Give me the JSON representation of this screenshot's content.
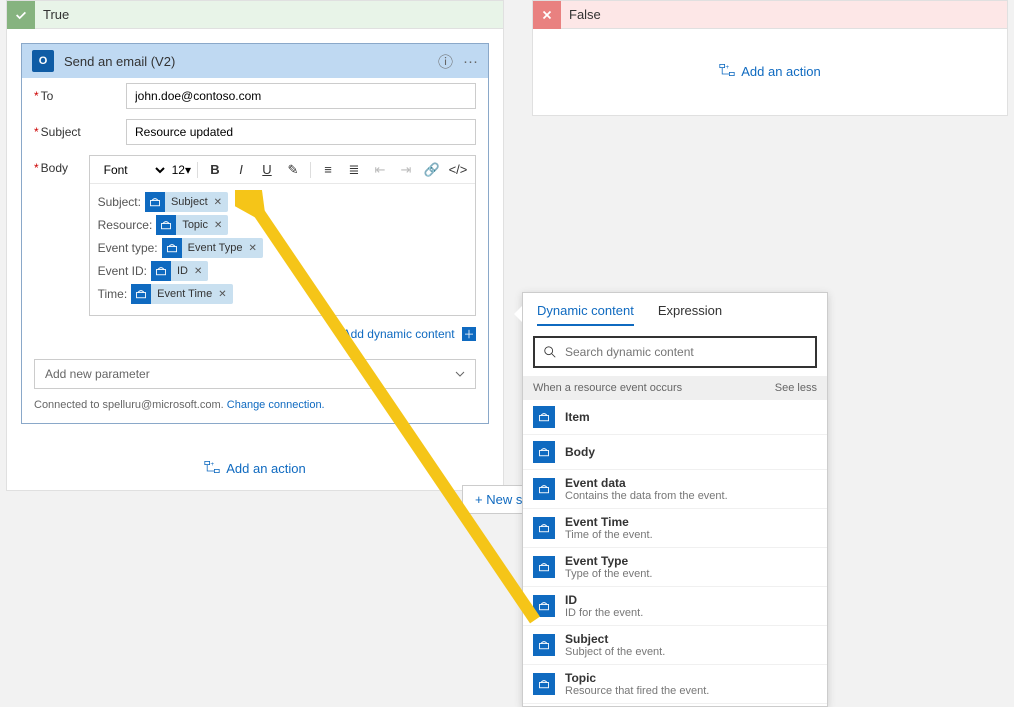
{
  "branches": {
    "true_label": "True",
    "false_label": "False",
    "add_action": "Add an action"
  },
  "action": {
    "title": "Send an email (V2)",
    "to_label": "To",
    "to_value": "john.doe@contoso.com",
    "subject_label": "Subject",
    "subject_value": "Resource updated",
    "body_label": "Body",
    "font_label": "Font",
    "size_label": "12",
    "body_lines": [
      {
        "label": "Subject:",
        "token": "Subject"
      },
      {
        "label": "Resource:",
        "token": "Topic"
      },
      {
        "label": "Event type:",
        "token": "Event Type"
      },
      {
        "label": "Event ID:",
        "token": "ID"
      },
      {
        "label": "Time:",
        "token": "Event Time"
      }
    ],
    "dyn_link": "Add dynamic content",
    "new_param": "Add new parameter",
    "connected": "Connected to spelluru@microsoft.com.",
    "change_conn": "Change connection."
  },
  "new_step": "+ New step",
  "flyout": {
    "tab_dynamic": "Dynamic content",
    "tab_expression": "Expression",
    "search_placeholder": "Search dynamic content",
    "group": "When a resource event occurs",
    "see_less": "See less",
    "items": [
      {
        "t": "Item",
        "d": ""
      },
      {
        "t": "Body",
        "d": ""
      },
      {
        "t": "Event data",
        "d": "Contains the data from the event."
      },
      {
        "t": "Event Time",
        "d": "Time of the event."
      },
      {
        "t": "Event Type",
        "d": "Type of the event."
      },
      {
        "t": "ID",
        "d": "ID for the event."
      },
      {
        "t": "Subject",
        "d": "Subject of the event."
      },
      {
        "t": "Topic",
        "d": "Resource that fired the event."
      }
    ]
  }
}
